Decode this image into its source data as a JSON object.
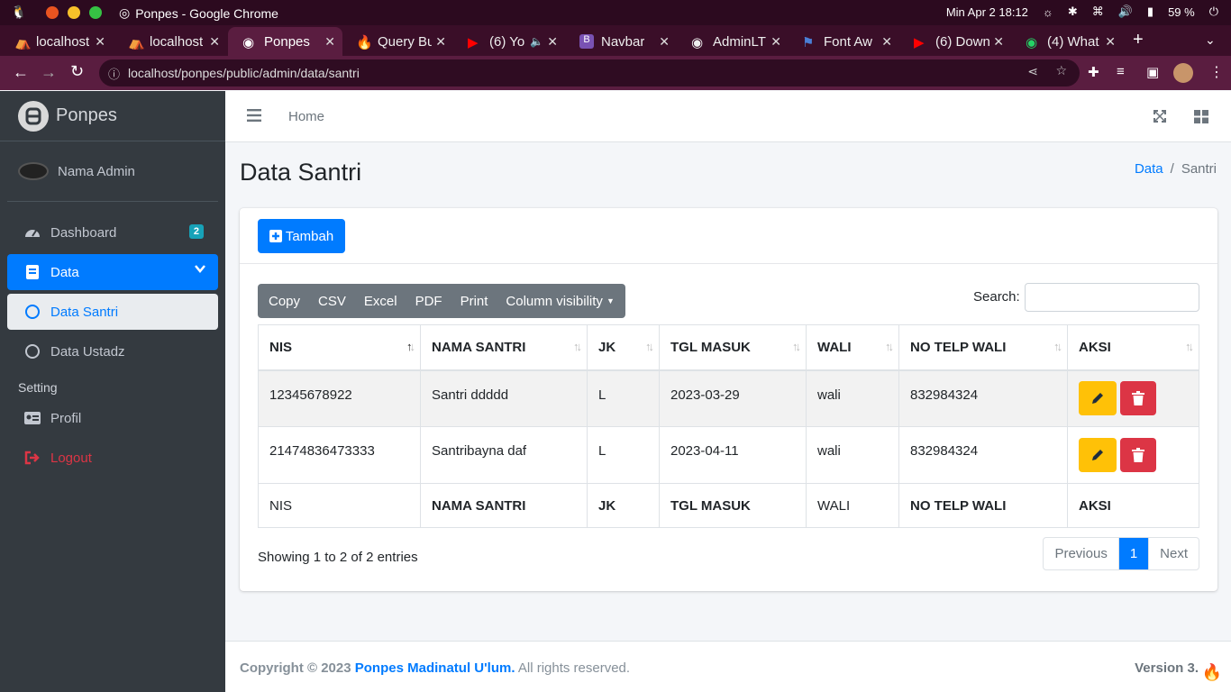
{
  "os": {
    "window_title": "Ponpes - Google Chrome",
    "clock": "Min Apr 2  18:12",
    "battery": "59 %"
  },
  "browser": {
    "tabs": [
      {
        "label": "localhost",
        "icon": "codeigniter-icon"
      },
      {
        "label": "localhost",
        "icon": "codeigniter-icon"
      },
      {
        "label": "Ponpes",
        "icon": "globe-icon"
      },
      {
        "label": "Query Bu",
        "icon": "codeigniter-icon"
      },
      {
        "label": "(6) Yo",
        "icon": "youtube-icon"
      },
      {
        "label": "Navbar",
        "icon": "bootstrap-icon"
      },
      {
        "label": "AdminLT",
        "icon": "globe-icon"
      },
      {
        "label": "Font Aw",
        "icon": "flag-icon"
      },
      {
        "label": "(6) Down",
        "icon": "youtube-icon"
      },
      {
        "label": "(4) What",
        "icon": "whatsapp-icon"
      }
    ],
    "url": "localhost/ponpes/public/admin/data/santri"
  },
  "sidebar": {
    "brand": "Ponpes",
    "user_name": "Nama Admin",
    "items": [
      {
        "label": "Dashboard",
        "badge": "2"
      },
      {
        "label": "Data"
      },
      {
        "label": "Data Santri"
      },
      {
        "label": "Data Ustadz"
      }
    ],
    "header_setting": "Setting",
    "profil": "Profil",
    "logout": "Logout"
  },
  "topnav": {
    "home": "Home"
  },
  "page": {
    "title": "Data Santri",
    "breadcrumb": [
      "Data",
      "/",
      "Santri"
    ]
  },
  "toolbar": {
    "add_label": "Tambah",
    "export_buttons": [
      "Copy",
      "CSV",
      "Excel",
      "PDF",
      "Print",
      "Column visibility"
    ],
    "search_label": "Search:",
    "search_value": ""
  },
  "table": {
    "columns": [
      "NIS",
      "NAMA SANTRI",
      "JK",
      "TGL MASUK",
      "WALI",
      "NO TELP WALI",
      "AKSI"
    ],
    "rows": [
      [
        "12345678922",
        "Santri ddddd",
        "L",
        "2023-03-29",
        "wali",
        "832984324"
      ],
      [
        "21474836473333",
        "Santribayna daf",
        "L",
        "2023-04-11",
        "wali",
        "832984324"
      ]
    ],
    "footer": [
      "NIS",
      "NAMA SANTRI",
      "JK",
      "TGL MASUK",
      "WALI",
      "NO TELP WALI",
      "AKSI"
    ]
  },
  "pagination": {
    "info": "Showing 1 to 2 of 2 entries",
    "previous": "Previous",
    "current": "1",
    "next": "Next"
  },
  "footer": {
    "copyright": "Copyright © 2023",
    "org": "Ponpes Madinatul U'lum.",
    "rights": "All rights reserved.",
    "version": "Version 3."
  },
  "colors": {
    "primary": "#007bff",
    "sidebar_bg": "#343a40",
    "warning": "#ffc107",
    "danger": "#dc3545"
  }
}
